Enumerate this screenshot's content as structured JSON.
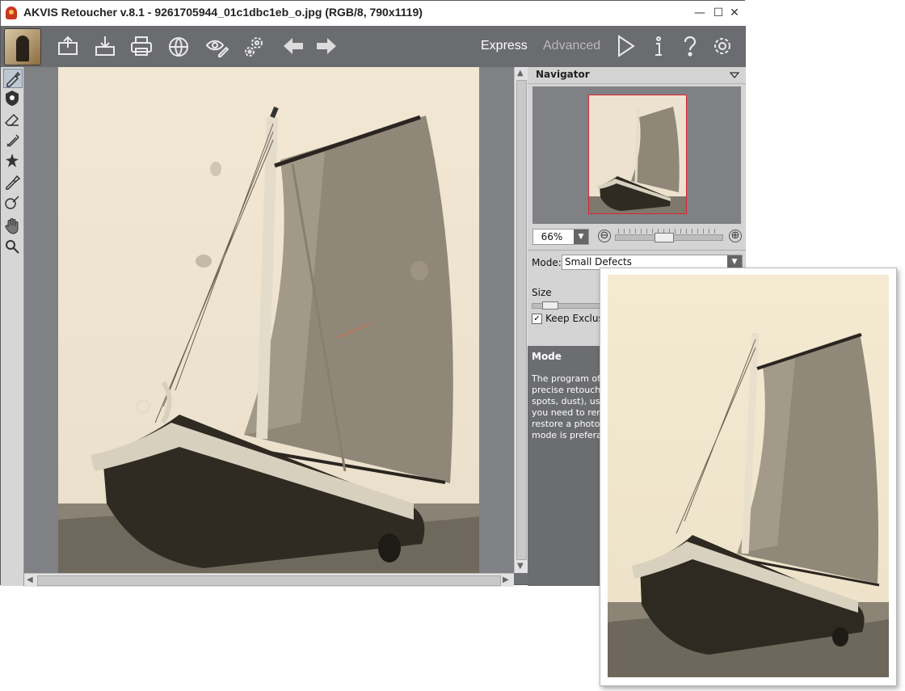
{
  "window": {
    "title": "AKVIS Retoucher v.8.1 - 9261705944_01c1dbc1eb_o.jpg (RGB/8, 790x1119)",
    "controls": {
      "minimize": "—",
      "maximize": "☐",
      "close": "✕"
    }
  },
  "toolbar": {
    "buttons": [
      {
        "name": "open-image-button",
        "icon": "open-icon"
      },
      {
        "name": "save-image-button",
        "icon": "save-icon"
      },
      {
        "name": "print-button",
        "icon": "print-icon"
      },
      {
        "name": "share-button",
        "icon": "share-icon"
      },
      {
        "name": "batch-button",
        "icon": "eye-pencil-icon"
      },
      {
        "name": "plugin-settings-button",
        "icon": "gears-icon"
      },
      {
        "name": "undo-button",
        "icon": "arrow-left-icon"
      },
      {
        "name": "redo-button",
        "icon": "arrow-right-icon"
      }
    ],
    "mode_express": "Express",
    "mode_advanced": "Advanced",
    "right_buttons": [
      {
        "name": "run-button",
        "icon": "play-icon"
      },
      {
        "name": "info-button",
        "icon": "info-icon"
      },
      {
        "name": "help-button",
        "icon": "question-icon"
      },
      {
        "name": "preferences-button",
        "icon": "gear-icon"
      }
    ],
    "colors": {
      "active_mode": "#ffffff",
      "inactive_mode": "#b9b9b9"
    }
  },
  "left_tools": [
    "retouch-brush-icon",
    "clone-stamp-icon",
    "eraser-icon",
    "patch-icon",
    "magic-wand-icon",
    "pipette-icon",
    "selection-brush-icon",
    "hand-icon",
    "zoom-icon"
  ],
  "navigator": {
    "title": "Navigator",
    "zoom": "66%",
    "zoom_percent": 66,
    "zoom_out": "⊖",
    "zoom_in": "⊕"
  },
  "settings": {
    "mode_label": "Mode:",
    "mode_value": "Small Defects",
    "size_label": "Size",
    "keep_exclusion_label": "Keep Exclusion",
    "keep_exclusion_checked": "✓"
  },
  "help": {
    "title": "Mode",
    "text": "The program of\nprecise retouchi\nspots, dust), us\nyou need to ren\nrestore a photo,\nmode is preferal"
  },
  "colors": {
    "app_bg": "#6f7073",
    "panel_bg": "#d4d4d4",
    "sepia_light": "#efe6d4",
    "sepia_dark": "#2f2a22",
    "nav_frame": "#dd2233"
  }
}
